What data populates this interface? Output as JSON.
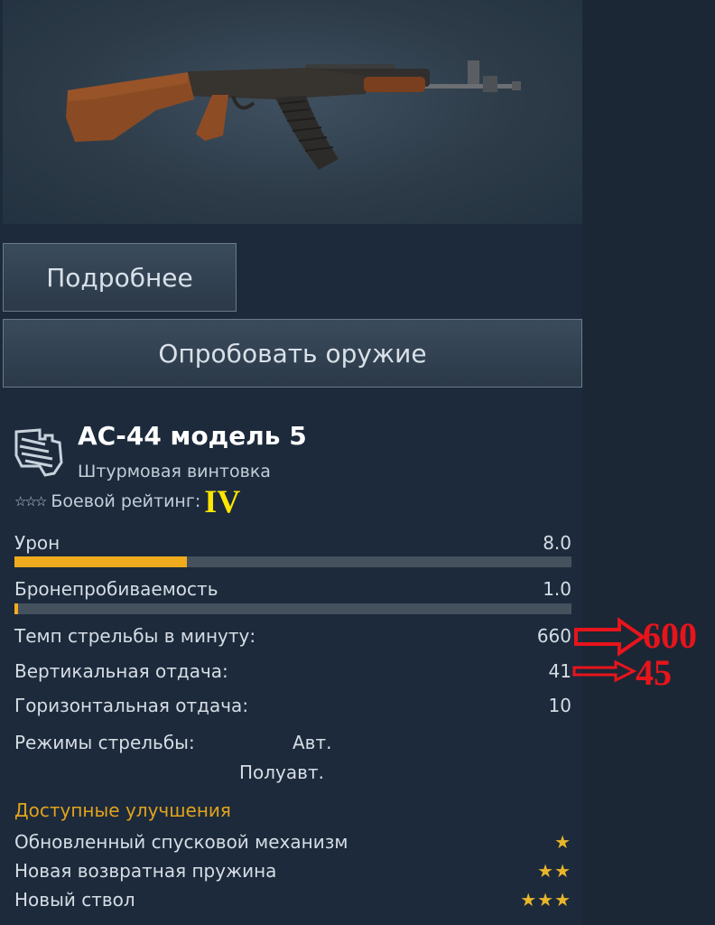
{
  "actions": {
    "details_label": "Подробнее",
    "try_label": "Опробовать оружие"
  },
  "weapon": {
    "name": "АС-44 модель 5",
    "type": "Штурмовая винтовка",
    "type_icon": "assault-rifle-icon",
    "rating_stars": "☆☆☆",
    "rating_label": "Боевой рейтинг:",
    "rating_value": "IV"
  },
  "stats": {
    "damage": {
      "label": "Урон",
      "value": "8.0",
      "fill": 0.31
    },
    "penetration": {
      "label": "Бронепробиваемость",
      "value": "1.0",
      "fill": 0.007
    },
    "rate_of_fire": {
      "label": "Темп стрельбы в минуту:",
      "value": "660"
    },
    "vertical_recoil": {
      "label": "Вертикальная отдача:",
      "value": "41"
    },
    "horizontal_recoil": {
      "label": "Горизонтальная отдача:",
      "value": "10"
    },
    "fire_modes": {
      "label": "Режимы стрельбы:",
      "mode1": "Авт.",
      "mode2": "Полуавт."
    }
  },
  "upgrades": {
    "title": "Доступные улучшения",
    "items": [
      {
        "label": "Обновленный спусковой механизм",
        "stars": "★"
      },
      {
        "label": "Новая возвратная пружина",
        "stars": "★★"
      },
      {
        "label": "Новый ствол",
        "stars": "★★★"
      }
    ]
  },
  "annotations": {
    "rate_of_fire_new": "600",
    "vertical_recoil_new": "45"
  },
  "colors": {
    "panel": "#1c2a3c",
    "bar_fill": "#f1ab1e",
    "bar_track": "#45515d",
    "accent_yellow": "#ffe600",
    "upgrade_title": "#e2a31b",
    "annotation_red": "#e8141b"
  }
}
